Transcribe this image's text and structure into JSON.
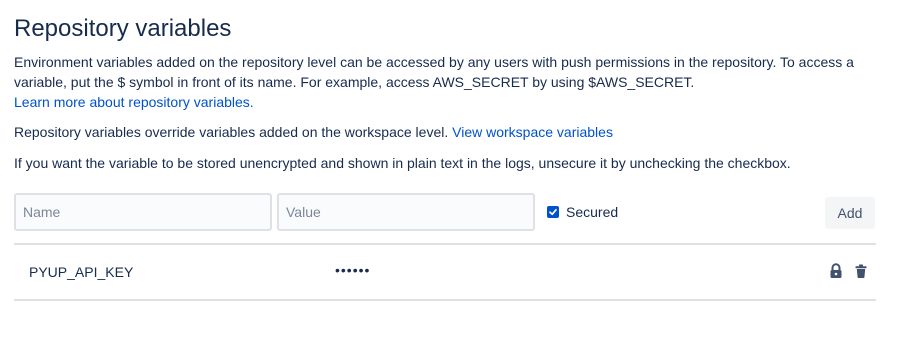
{
  "title": "Repository variables",
  "intro": {
    "text": "Environment variables added on the repository level can be accessed by any users with push permissions in the repository. To access a variable, put the $ symbol in front of its name. For example, access AWS_SECRET by using $AWS_SECRET.",
    "link": "Learn more about repository variables."
  },
  "override": {
    "text": "Repository variables override variables added on the workspace level. ",
    "link": "View workspace variables"
  },
  "hint": "If you want the variable to be stored unencrypted and shown in plain text in the logs, unsecure it by unchecking the checkbox.",
  "form": {
    "name_placeholder": "Name",
    "value_placeholder": "Value",
    "secured_label": "Secured",
    "secured_checked": true,
    "add_label": "Add"
  },
  "variables": [
    {
      "key": "PYUP_API_KEY",
      "value": "••••••",
      "secured": true,
      "icons": [
        "lock-icon",
        "trash-icon"
      ]
    }
  ],
  "colors": {
    "link": "#0052cc",
    "text": "#172b4d",
    "checkbox": "#0052cc",
    "button_bg": "#f4f5f7"
  }
}
